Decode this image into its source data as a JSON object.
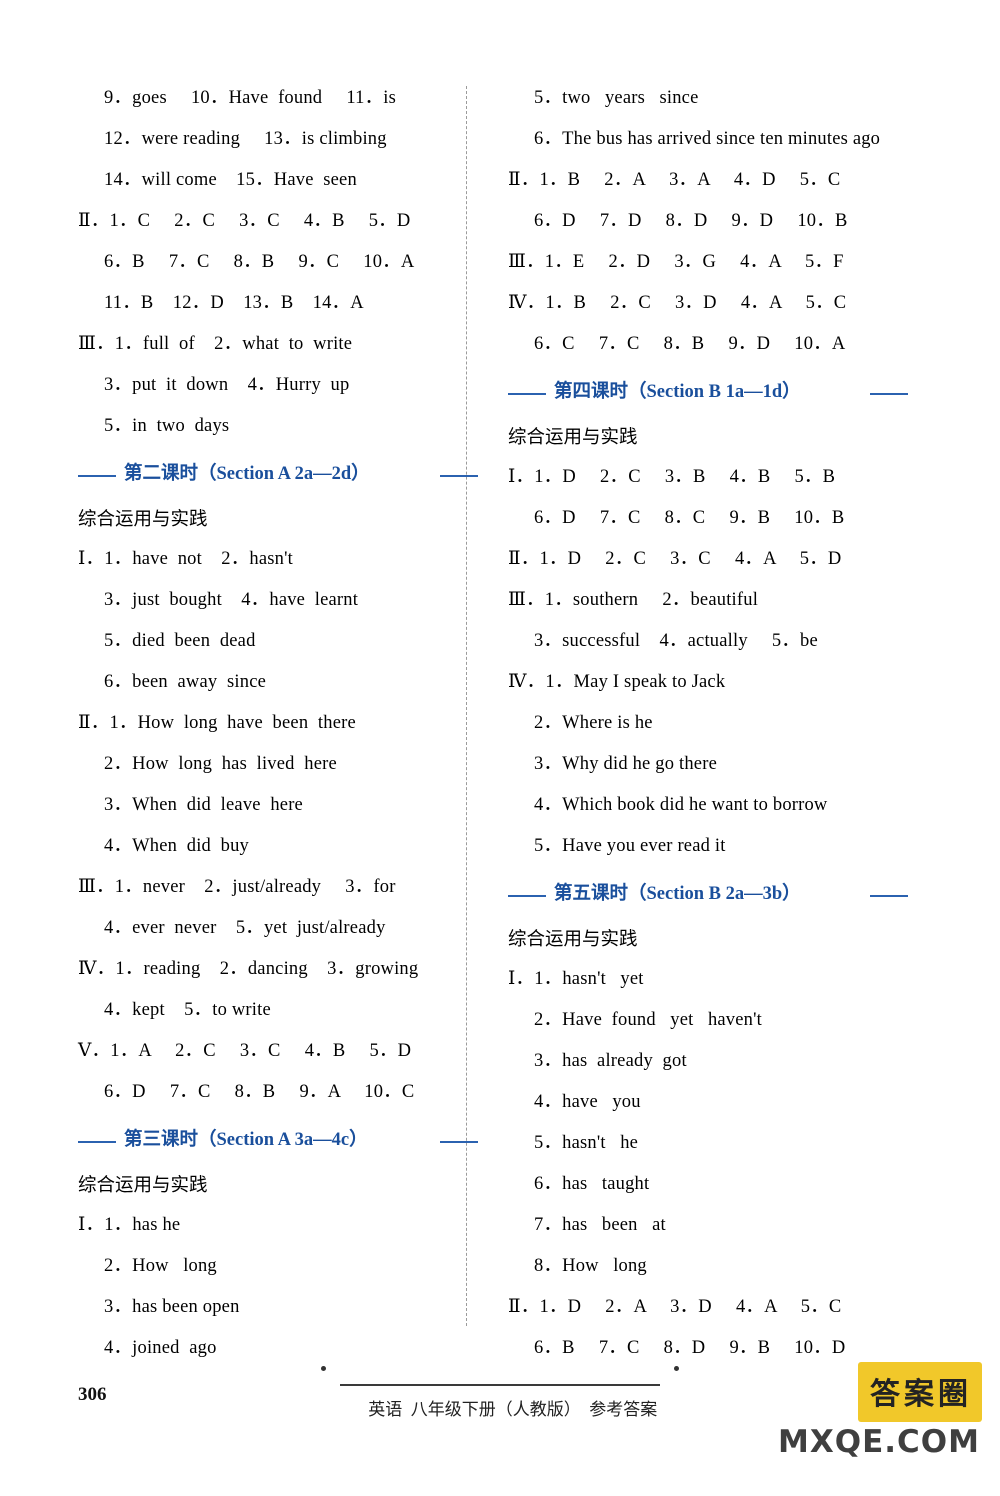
{
  "page": {
    "number": "306",
    "footer_text": "英语  八年级下册（人教版）  参考答案"
  },
  "watermark": {
    "box_text": "答案圈",
    "url_text": "MXQE.COM"
  },
  "left_column": {
    "blocks": [
      {
        "type": "lines",
        "lines": [
          "9．goes     10．Have  found     11．is",
          "12．were reading     13．is climbing",
          "14．will come    15．Have  seen"
        ],
        "indents": [
          1,
          1,
          1
        ]
      },
      {
        "type": "lines",
        "lines": [
          "Ⅱ．1．C     2．C     3．C     4．B     5．D",
          "6．B     7．C     8．B     9．C     10．A",
          "11．B    12．D    13．B    14．A"
        ],
        "indents": [
          0,
          1,
          1
        ]
      },
      {
        "type": "lines",
        "lines": [
          "Ⅲ．1．full  of    2．what  to  write",
          "3．put  it  down    4．Hurry  up",
          "5．in  two  days"
        ],
        "indents": [
          0,
          1,
          1
        ]
      },
      {
        "type": "heading",
        "label": "第二课时（Section A 2a—2d）"
      },
      {
        "type": "subheading",
        "label": "综合运用与实践"
      },
      {
        "type": "lines",
        "lines": [
          "Ⅰ．1．have  not    2．hasn't",
          "3．just  bought    4．have  learnt",
          "5．died  been  dead",
          "6．been  away  since"
        ],
        "indents": [
          0,
          1,
          1,
          1
        ]
      },
      {
        "type": "lines",
        "lines": [
          "Ⅱ．1．How  long  have  been  there",
          "2．How  long  has  lived  here",
          "3．When  did  leave  here",
          "4．When  did  buy"
        ],
        "indents": [
          0,
          1,
          1,
          1
        ]
      },
      {
        "type": "lines",
        "lines": [
          "Ⅲ．1．never    2．just/already     3．for",
          "4．ever  never    5．yet  just/already"
        ],
        "indents": [
          0,
          1
        ]
      },
      {
        "type": "lines",
        "lines": [
          "Ⅳ．1．reading    2．dancing    3．growing",
          "4．kept    5．to write"
        ],
        "indents": [
          0,
          1
        ]
      },
      {
        "type": "lines",
        "lines": [
          "Ⅴ．1．A     2．C     3．C     4．B     5．D",
          "6．D     7．C     8．B     9．A     10．C"
        ],
        "indents": [
          0,
          1
        ]
      },
      {
        "type": "heading",
        "label": "第三课时（Section A 3a—4c）"
      },
      {
        "type": "subheading",
        "label": "综合运用与实践"
      },
      {
        "type": "lines",
        "lines": [
          "Ⅰ．1．has he",
          "2．How   long",
          "3．has been open",
          "4．joined  ago"
        ],
        "indents": [
          0,
          1,
          1,
          1
        ]
      }
    ]
  },
  "right_column": {
    "blocks": [
      {
        "type": "lines",
        "lines": [
          "5．two   years   since",
          "6．The bus has arrived since ten minutes ago"
        ],
        "indents": [
          1,
          1
        ]
      },
      {
        "type": "lines",
        "lines": [
          "Ⅱ．1．B     2．A     3．A     4．D     5．C",
          "6．D     7．D     8．D     9．D     10．B"
        ],
        "indents": [
          0,
          1
        ]
      },
      {
        "type": "lines",
        "lines": [
          "Ⅲ．1．E     2．D     3．G     4．A     5．F"
        ],
        "indents": [
          0
        ]
      },
      {
        "type": "lines",
        "lines": [
          "Ⅳ．1．B     2．C     3．D     4．A     5．C",
          "6．C     7．C     8．B     9．D     10．A"
        ],
        "indents": [
          0,
          1
        ]
      },
      {
        "type": "heading",
        "label": "第四课时（Section B 1a—1d）"
      },
      {
        "type": "subheading",
        "label": "综合运用与实践"
      },
      {
        "type": "lines",
        "lines": [
          "Ⅰ．1．D     2．C     3．B     4．B     5．B",
          "6．D     7．C     8．C     9．B     10．B"
        ],
        "indents": [
          0,
          1
        ]
      },
      {
        "type": "lines",
        "lines": [
          "Ⅱ．1．D     2．C     3．C     4．A     5．D"
        ],
        "indents": [
          0
        ]
      },
      {
        "type": "lines",
        "lines": [
          "Ⅲ．1．southern     2．beautiful",
          "3．successful    4．actually     5．be"
        ],
        "indents": [
          0,
          1
        ]
      },
      {
        "type": "lines",
        "lines": [
          "Ⅳ．1．May I speak to Jack",
          "2．Where is he",
          "3．Why did he go there",
          "4．Which book did he want to borrow",
          "5．Have you ever read it"
        ],
        "indents": [
          0,
          1,
          1,
          1,
          1
        ]
      },
      {
        "type": "heading",
        "label": "第五课时（Section B 2a—3b）"
      },
      {
        "type": "subheading",
        "label": "综合运用与实践"
      },
      {
        "type": "lines",
        "lines": [
          "Ⅰ．1．hasn't   yet",
          "2．Have  found   yet   haven't",
          "3．has  already  got",
          "4．have   you",
          "5．hasn't   he",
          "6．has   taught",
          "7．has   been   at",
          "8．How   long"
        ],
        "indents": [
          0,
          1,
          1,
          1,
          1,
          1,
          1,
          1
        ]
      },
      {
        "type": "lines",
        "lines": [
          "Ⅱ．1．D     2．A     3．D     4．A     5．C",
          "6．B     7．C     8．D     9．B     10．D"
        ],
        "indents": [
          0,
          1
        ]
      }
    ]
  }
}
